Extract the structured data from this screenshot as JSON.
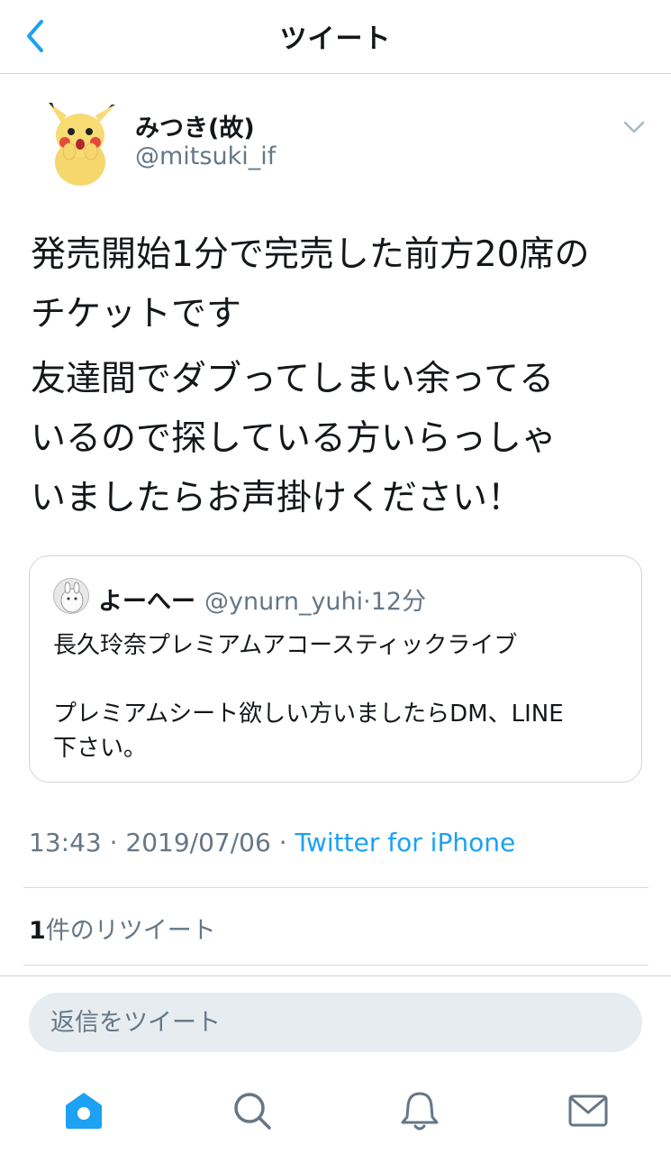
{
  "header": {
    "title": "ツイート"
  },
  "tweet": {
    "author_name": "みつき(故)",
    "author_handle": "@mitsuki_if",
    "paragraphs": [
      "発売開始1分で完売した前方20席の\nチケットです",
      "友達間でダブってしまい余ってる\nいるので探している方いらっしゃ\nいましたらお声掛けください！"
    ],
    "time": "13:43",
    "date": "2019/07/06",
    "source": "Twitter for iPhone",
    "retweet_count": "1",
    "retweet_label": "件のリツイート"
  },
  "quoted_tweet": {
    "author_name": "よーへー",
    "author_handle": "@ynurn_yuhi",
    "time_ago": "12分",
    "text": "長久玲奈プレミアムアコースティックライブ\n\nプレミアムシート欲しい方いましたらDM、LINE\n下さい。"
  },
  "reply": {
    "placeholder": "返信をツイート"
  },
  "tab_bar": {
    "tabs": [
      "home-icon",
      "search-icon",
      "notifications-icon",
      "messages-icon"
    ]
  },
  "colors": {
    "accent": "#1da1f2",
    "secondary_text": "#657786",
    "primary_text": "#14171a"
  }
}
